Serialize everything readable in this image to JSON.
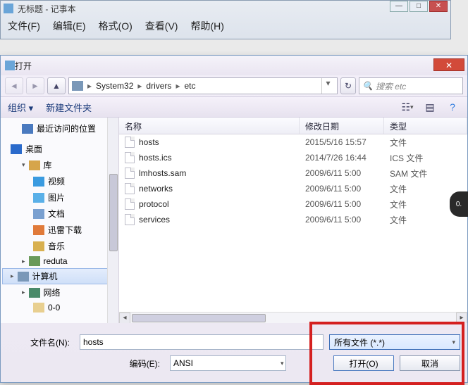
{
  "notepad": {
    "title": "无标题 - 记事本",
    "menu": {
      "file": "文件(F)",
      "edit": "编辑(E)",
      "format": "格式(O)",
      "view": "查看(V)",
      "help": "帮助(H)"
    }
  },
  "dialog": {
    "title": "打开",
    "nav": {
      "pathSegments": [
        "System32",
        "drivers",
        "etc"
      ],
      "searchPlaceholder": "搜索 etc"
    },
    "toolbar": {
      "organize": "组织 ▾",
      "newFolder": "新建文件夹"
    },
    "sidebar": {
      "recent": "最近访问的位置",
      "desktop": "桌面",
      "libraries": "库",
      "videos": "视频",
      "pictures": "图片",
      "documents": "文档",
      "thunder": "迅雷下载",
      "music": "音乐",
      "user": "reduta",
      "computer": "计算机",
      "network": "网络",
      "folder0": "0-0"
    },
    "columns": {
      "name": "名称",
      "date": "修改日期",
      "type": "类型"
    },
    "files": [
      {
        "name": "hosts",
        "date": "2015/5/16 15:57",
        "type": "文件"
      },
      {
        "name": "hosts.ics",
        "date": "2014/7/26 16:44",
        "type": "ICS 文件"
      },
      {
        "name": "lmhosts.sam",
        "date": "2009/6/11 5:00",
        "type": "SAM 文件"
      },
      {
        "name": "networks",
        "date": "2009/6/11 5:00",
        "type": "文件"
      },
      {
        "name": "protocol",
        "date": "2009/6/11 5:00",
        "type": "文件"
      },
      {
        "name": "services",
        "date": "2009/6/11 5:00",
        "type": "文件"
      }
    ],
    "form": {
      "filenameLabel": "文件名(N):",
      "filenameValue": "hosts",
      "encodingLabel": "编码(E):",
      "encodingValue": "ANSI",
      "filterValue": "所有文件 (*.*)",
      "openBtn": "打开(O)",
      "cancelBtn": "取消"
    }
  },
  "sideBadge": "0."
}
